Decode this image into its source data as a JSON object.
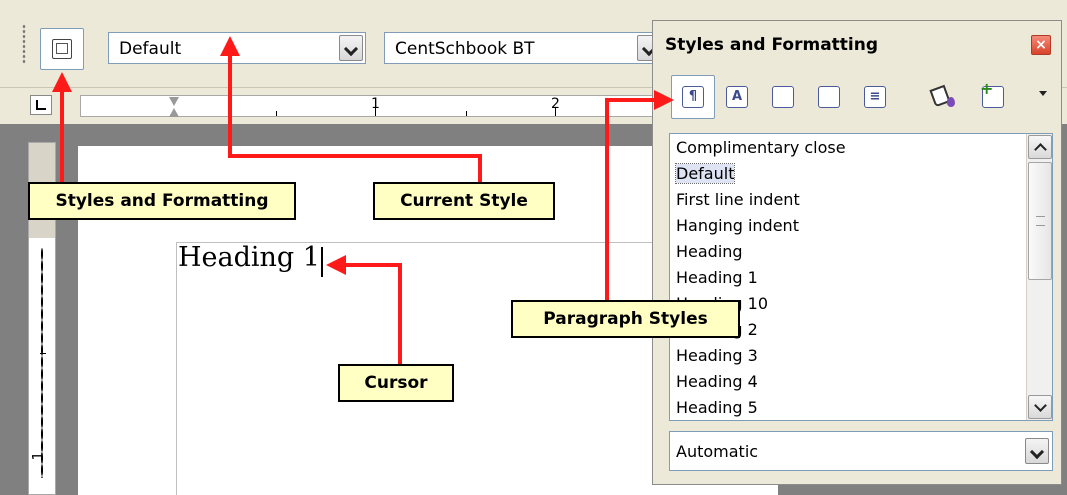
{
  "toolbar": {
    "current_style": "Default",
    "font_name": "CentSchbook BT"
  },
  "ruler": {
    "horizontal_numbers": [
      "1",
      "2"
    ],
    "vertical_numbers": [
      "1"
    ]
  },
  "document": {
    "heading_text": "Heading 1"
  },
  "panel": {
    "title": "Styles and Formatting",
    "close_label": "×",
    "style_families": [
      "paragraph-styles",
      "character-styles",
      "frame-styles",
      "page-styles",
      "list-styles"
    ],
    "styles": [
      "Complimentary close",
      "Default",
      "First line indent",
      "Hanging indent",
      "Heading",
      "Heading 1",
      "Heading 10",
      "Heading 2",
      "Heading 3",
      "Heading 4",
      "Heading 5"
    ],
    "selected_style": "Default",
    "filter": "Automatic"
  },
  "callouts": {
    "styles_and_formatting": "Styles and Formatting",
    "current_style": "Current Style",
    "paragraph_styles": "Paragraph Styles",
    "cursor": "Cursor"
  },
  "colors": {
    "callout_fill": "#ffffc4",
    "arrow": "#ff1a1a",
    "chrome": "#ece9d8",
    "workspace": "#808080"
  }
}
